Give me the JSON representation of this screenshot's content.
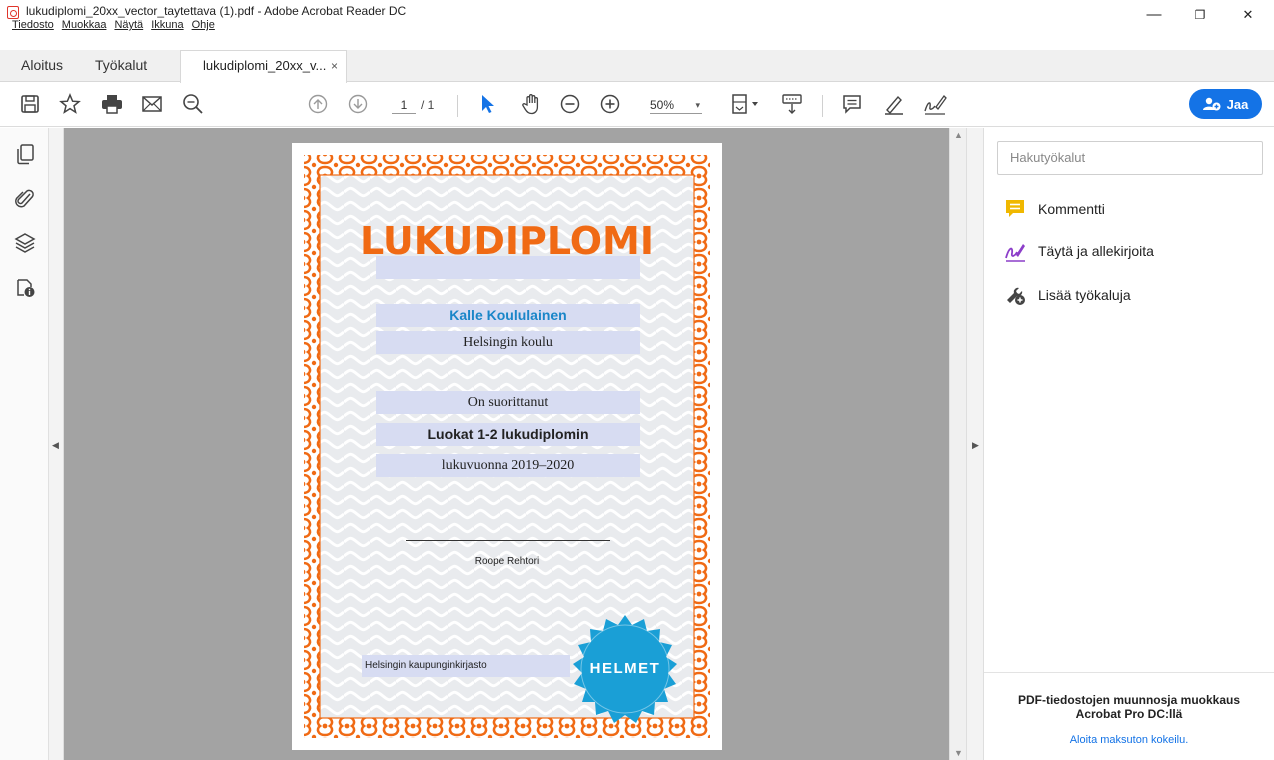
{
  "window": {
    "title": "lukudiplomi_20xx_vector_taytettava (1).pdf - Adobe Acrobat Reader DC",
    "minimize": "—",
    "restore": "❐",
    "close": "✕"
  },
  "menu": [
    "Tiedosto",
    "Muokkaa",
    "Näytä",
    "Ikkuna",
    "Ohje"
  ],
  "tabs": {
    "home": "Aloitus",
    "tools": "Työkalut",
    "document": "lukudiplomi_20xx_v...",
    "document_close": "×"
  },
  "toolbar": {
    "page_current": "1",
    "page_total": "/ 1",
    "zoom": "50%",
    "zoom_caret": "▾",
    "share_label": "Jaa"
  },
  "document": {
    "heading": "LUKUDIPLOMI",
    "subtitle_field": "",
    "student_name": "Kalle Koululainen",
    "school": "Helsingin koulu",
    "completed": "On suorittanut",
    "diploma": "Luokat 1-2 lukudiplomin",
    "year": "lukuvuonna 2019–2020",
    "signer": "Roope Rehtori",
    "library": "Helsingin kaupunginkirjasto",
    "badge": "HELMET"
  },
  "right_panel": {
    "search_placeholder": "Hakutyökalut",
    "tools": [
      {
        "label": "Kommentti",
        "icon": "comment-icon"
      },
      {
        "label": "Täytä ja allekirjoita",
        "icon": "fill-sign-icon"
      },
      {
        "label": "Lisää työkaluja",
        "icon": "more-tools-icon"
      }
    ],
    "promo_line1": "PDF-tiedostojen muunnosja muokkaus",
    "promo_line2": "Acrobat Pro DC:llä",
    "promo_link": "Aloita maksuton kokeilu."
  },
  "colors": {
    "accent": "#1473e6",
    "border_orange": "#f06a14",
    "badge_blue": "#1a9fd6",
    "field_fill": "#d7dcf2"
  }
}
